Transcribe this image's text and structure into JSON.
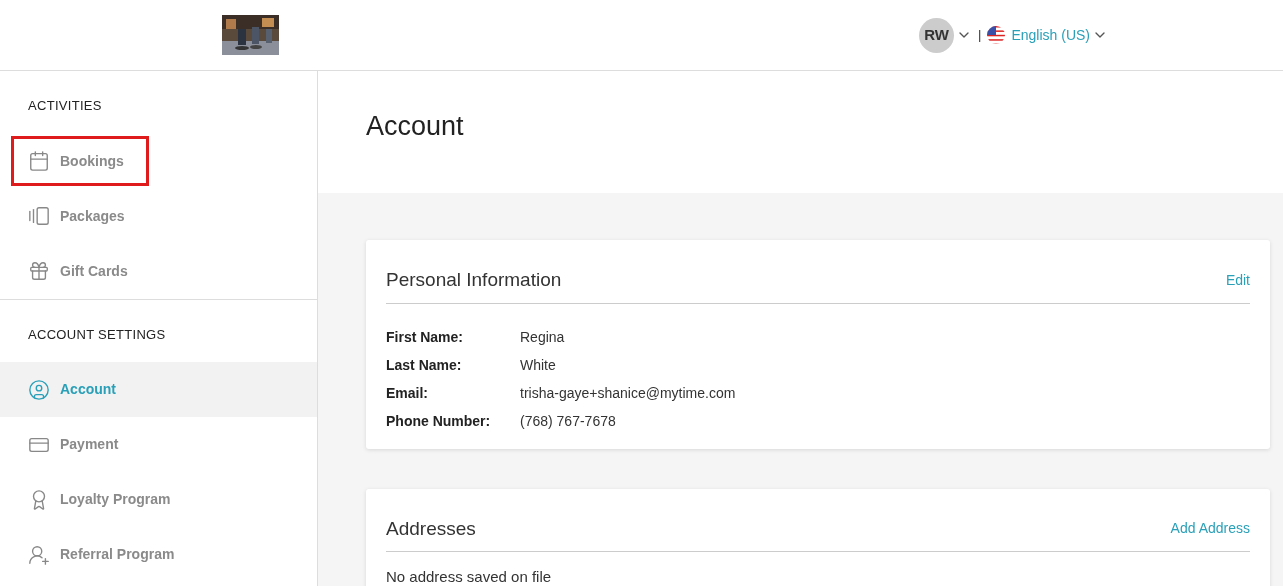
{
  "header": {
    "user": {
      "initials": "RW"
    },
    "separator": "|",
    "language": "English (US)"
  },
  "sidebar": {
    "sections": [
      {
        "title": "ACTIVITIES",
        "items": [
          {
            "label": "Bookings",
            "kind": "calendar",
            "selected": false,
            "highlighted": true
          },
          {
            "label": "Packages",
            "kind": "cards",
            "selected": false,
            "highlighted": false
          },
          {
            "label": "Gift Cards",
            "kind": "gift",
            "selected": false,
            "highlighted": false
          }
        ]
      },
      {
        "title": "ACCOUNT SETTINGS",
        "items": [
          {
            "label": "Account",
            "kind": "user",
            "selected": true,
            "highlighted": false
          },
          {
            "label": "Payment",
            "kind": "card",
            "selected": false,
            "highlighted": false
          },
          {
            "label": "Loyalty Program",
            "kind": "award",
            "selected": false,
            "highlighted": false
          },
          {
            "label": "Referral Program",
            "kind": "referral",
            "selected": false,
            "highlighted": false
          }
        ]
      }
    ]
  },
  "page": {
    "title": "Account"
  },
  "cards": [
    {
      "title": "Personal Information",
      "action": "Edit",
      "fields": [
        {
          "label": "First Name:",
          "value": "Regina"
        },
        {
          "label": "Last Name:",
          "value": "White"
        },
        {
          "label": "Email:",
          "value": "trisha-gaye+shanice@mytime.com"
        },
        {
          "label": "Phone Number:",
          "value": "(768) 767-7678"
        }
      ]
    },
    {
      "title": "Addresses",
      "action": "Add Address",
      "empty": "No address saved on file"
    }
  ]
}
